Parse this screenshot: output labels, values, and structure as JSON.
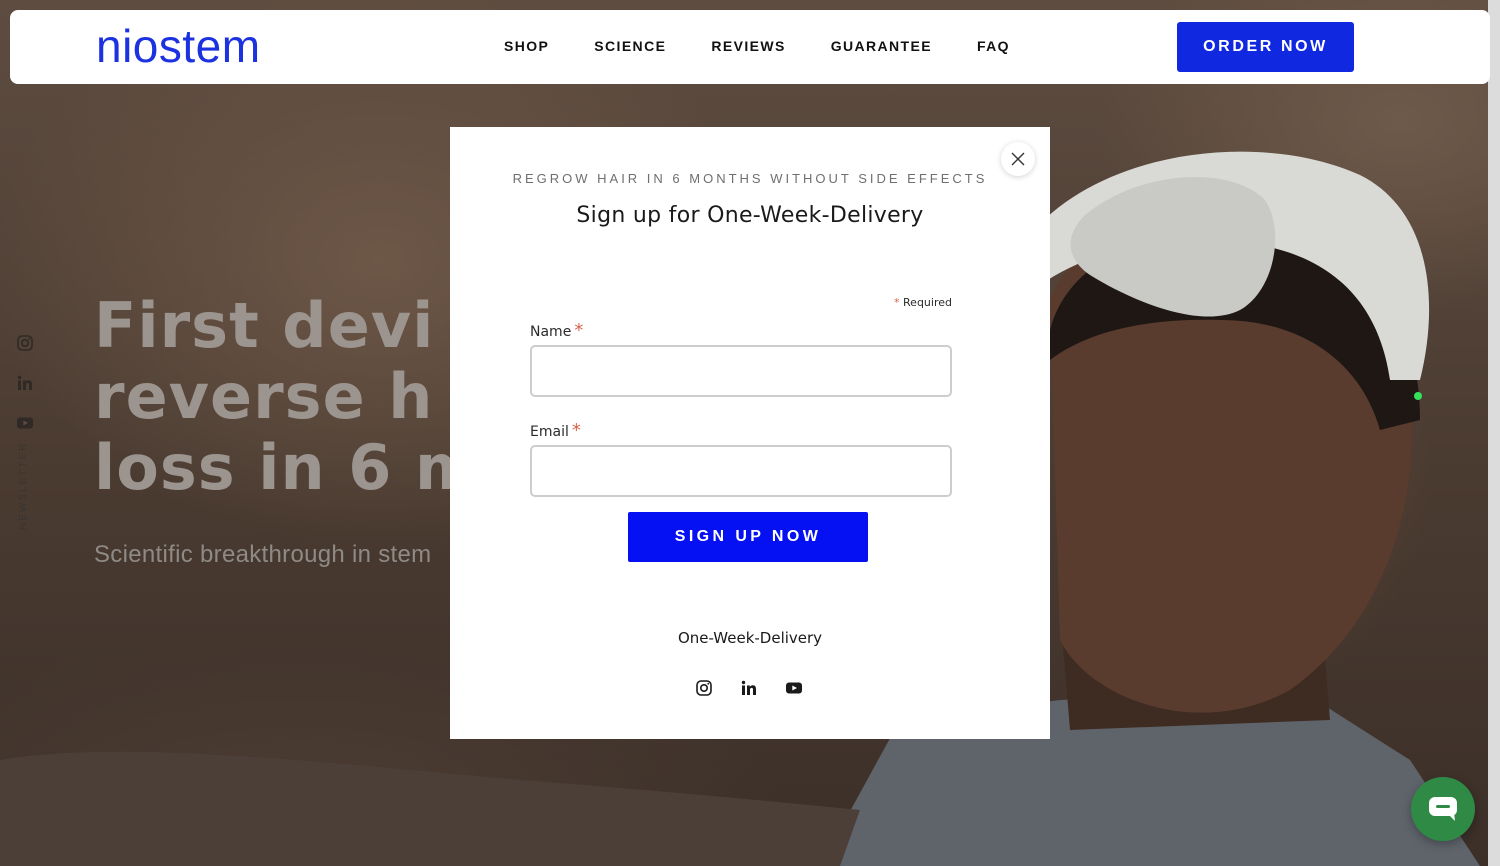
{
  "header": {
    "logo": "niostem",
    "nav": [
      "SHOP",
      "SCIENCE",
      "REVIEWS",
      "GUARANTEE",
      "FAQ"
    ],
    "order_button": "ORDER NOW",
    "colors": {
      "brand": "#1c32e0",
      "button": "#1029e0"
    }
  },
  "rail": {
    "icons": [
      "instagram-icon",
      "linkedin-icon",
      "youtube-icon"
    ],
    "label": "NEWSLETTER"
  },
  "hero": {
    "title_lines": [
      "First devi",
      "reverse h",
      "loss in 6 m"
    ],
    "subtitle": "Scientific breakthrough in stem"
  },
  "modal": {
    "eyebrow": "REGROW HAIR IN 6 MONTHS WITHOUT SIDE EFFECTS",
    "title": "Sign up for One-Week-Delivery",
    "required_note": "Required",
    "fields": {
      "name_label": "Name",
      "name_value": "",
      "email_label": "Email",
      "email_value": ""
    },
    "submit": "SIGN UP NOW",
    "footer_text": "One-Week-Delivery",
    "social_icons": [
      "instagram-icon",
      "linkedin-icon",
      "youtube-icon"
    ],
    "colors": {
      "submit": "#0511f2",
      "required": "#d9634a"
    }
  },
  "chat": {
    "icon": "chat-bubble-icon",
    "color": "#2f8a46"
  }
}
